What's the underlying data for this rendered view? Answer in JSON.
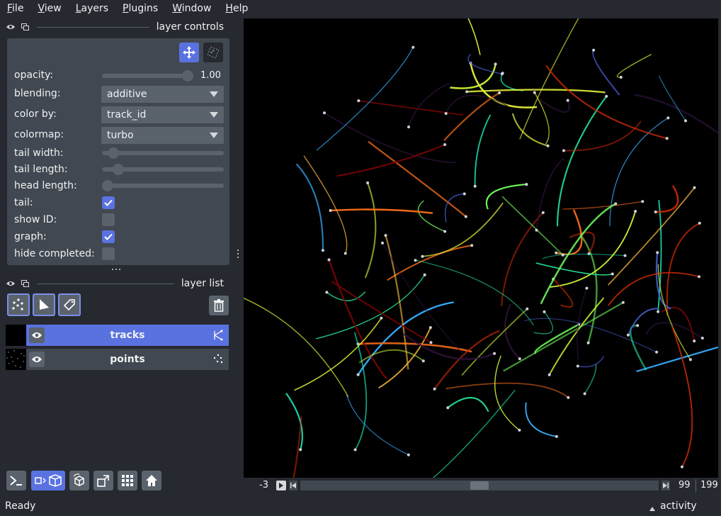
{
  "menu": [
    "File",
    "View",
    "Layers",
    "Plugins",
    "Window",
    "Help"
  ],
  "layer_controls": {
    "title": "layer controls",
    "opacity_label": "opacity:",
    "opacity_value": "1.00",
    "opacity": 1.0,
    "blending_label": "blending:",
    "blending_value": "additive",
    "color_by_label": "color by:",
    "color_by_value": "track_id",
    "colormap_label": "colormap:",
    "colormap_value": "turbo",
    "tail_width_label": "tail width:",
    "tail_width": 0.08,
    "tail_length_label": "tail length:",
    "tail_length": 0.13,
    "head_length_label": "head length:",
    "head_length": 0.0,
    "tail_label": "tail:",
    "tail_checked": true,
    "show_id_label": "show ID:",
    "show_id_checked": false,
    "graph_label": "graph:",
    "graph_checked": true,
    "hide_completed_label": "hide completed:",
    "hide_completed_checked": false
  },
  "layer_list": {
    "title": "layer list",
    "layers": [
      {
        "name": "tracks",
        "selected": true,
        "icon": "tracks-icon"
      },
      {
        "name": "points",
        "selected": false,
        "icon": "points-icon"
      }
    ]
  },
  "dims": {
    "start_label": "-3",
    "current": "99",
    "total": "199",
    "position_fraction": 0.5
  },
  "status": {
    "text": "Ready",
    "activity": "activity"
  },
  "colors": {
    "accent": "#5a72e0",
    "panel": "#414851",
    "background": "#262930"
  }
}
